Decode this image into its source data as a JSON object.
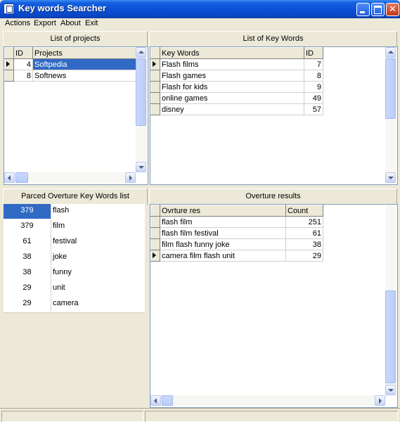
{
  "window": {
    "title": "Key words Searcher"
  },
  "menu": [
    "Actions",
    "Export",
    "About",
    "Exit"
  ],
  "projects_panel": {
    "title": "List of projects",
    "columns": [
      "ID",
      "Projects"
    ],
    "rows": [
      {
        "id": "4",
        "name": "Softpedia"
      },
      {
        "id": "8",
        "name": "Softnews"
      }
    ]
  },
  "keywords_panel": {
    "title": "List of Key Words",
    "columns": [
      "Key Words",
      "ID"
    ],
    "rows": [
      {
        "name": "Flash films",
        "id": "7"
      },
      {
        "name": "Flash games",
        "id": "8"
      },
      {
        "name": "Flash for kids",
        "id": "9"
      },
      {
        "name": "online games",
        "id": "49"
      },
      {
        "name": "disney",
        "id": "57"
      }
    ]
  },
  "parced_panel": {
    "title": "Parced Overture Key Words list",
    "rows": [
      {
        "count": "379",
        "word": "flash"
      },
      {
        "count": "379",
        "word": "film"
      },
      {
        "count": "61",
        "word": "festival"
      },
      {
        "count": "38",
        "word": "joke"
      },
      {
        "count": "38",
        "word": "funny"
      },
      {
        "count": "29",
        "word": "unit"
      },
      {
        "count": "29",
        "word": "camera"
      }
    ]
  },
  "results_panel": {
    "title": "Overture results",
    "columns": [
      "Ovrture res",
      "Count"
    ],
    "rows": [
      {
        "name": "flash film",
        "count": "251"
      },
      {
        "name": "flash film festival",
        "count": "61"
      },
      {
        "name": "film flash funny joke",
        "count": "38"
      },
      {
        "name": "camera film flash unit",
        "count": "29"
      }
    ]
  },
  "colors": {
    "selection": "#316ac5",
    "titlebar": "#0a4fd6",
    "face": "#ece9d8"
  },
  "icons": [
    "app-icon",
    "minimize-icon",
    "maximize-icon",
    "close-icon",
    "row-indicator-arrow-icon",
    "scroll-arrow-icon"
  ]
}
